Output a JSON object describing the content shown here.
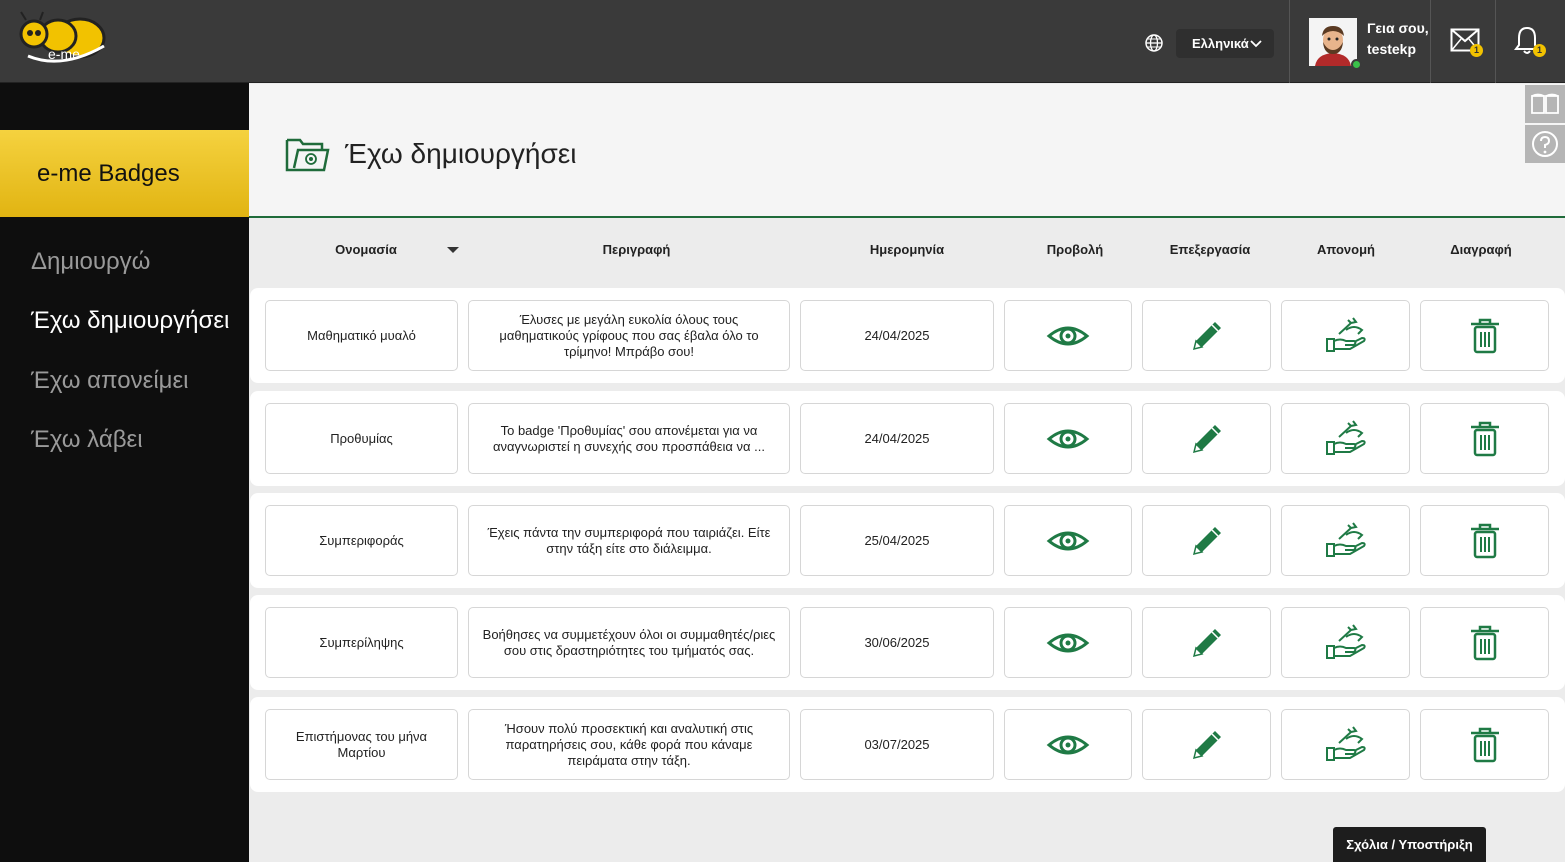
{
  "app": {
    "logo_text": "e-me",
    "language": "Ελληνικά",
    "greeting_line1": "Γεια σου,",
    "greeting_line2": "testekp",
    "mail_count": "1",
    "notification_count": "1"
  },
  "sidebar": {
    "header": "e-me Badges",
    "items": [
      {
        "label": "Δημιουργώ"
      },
      {
        "label": "Έχω δημιουργήσει"
      },
      {
        "label": "Έχω απονείμει"
      },
      {
        "label": "Έχω λάβει"
      }
    ]
  },
  "page": {
    "title": "Έχω δημιουργήσει"
  },
  "table": {
    "headers": [
      "Ονομασία",
      "Περιγραφή",
      "Ημερομηνία",
      "Προβολή",
      "Επεξεργασία",
      "Απονομή",
      "Διαγραφή"
    ],
    "rows": [
      {
        "name": "Μαθηματικό μυαλό",
        "description": "Έλυσες με μεγάλη ευκολία όλους τους μαθηματικούς γρίφους που σας έβαλα όλο το τρίμηνο! Μπράβο σου!",
        "date": "24/04/2025"
      },
      {
        "name": "Προθυμίας",
        "description": "Το badge 'Προθυμίας' σου απονέμεται για να αναγνωριστεί η συνεχής σου προσπάθεια να ...",
        "date": "24/04/2025"
      },
      {
        "name": "Συμπεριφοράς",
        "description": "Έχεις πάντα την συμπεριφορά που ταιριάζει. Είτε στην τάξη είτε στο διάλειμμα.",
        "date": "25/04/2025"
      },
      {
        "name": "Συμπερίληψης",
        "description": "Βοήθησες να συμμετέχουν όλοι οι συμμαθητές/ριες σου στις δραστηριότητες του τμήματός σας.",
        "date": "30/06/2025"
      },
      {
        "name": "Επιστήμονας του μήνα Μαρτίου",
        "description": "Ήσουν πολύ προσεκτική και αναλυτική στις παρατηρήσεις σου, κάθε φορά που κάναμε πειράματα στην τάξη.",
        "date": "03/07/2025"
      }
    ]
  },
  "footer": {
    "feedback": "Σχόλια / Υποστήριξη"
  },
  "colors": {
    "accent_green": "#1f7a45",
    "sidebar_yellow": "#f0c52a",
    "topbar": "#3a3a3a"
  }
}
